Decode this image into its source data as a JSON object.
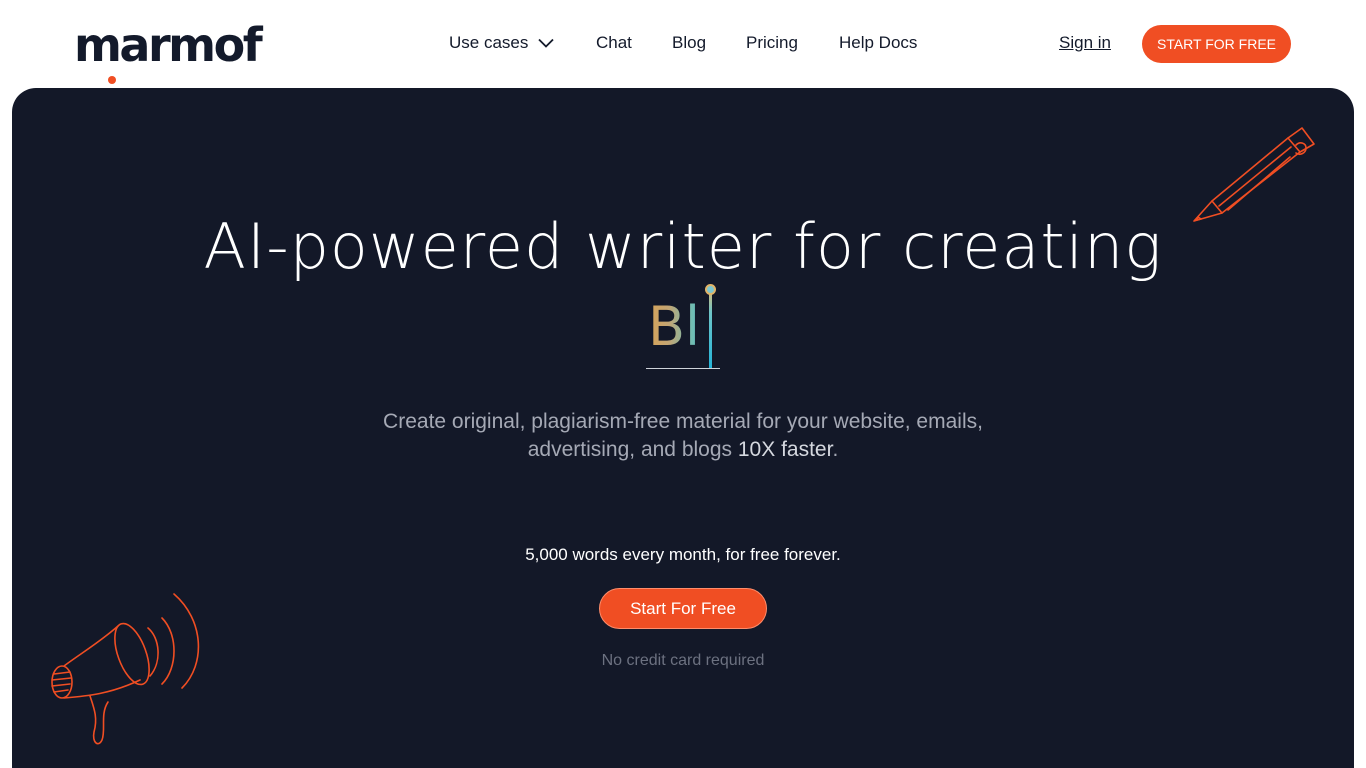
{
  "brand": {
    "name": "marmof",
    "accent_color": "#f04e23",
    "dark_color": "#131828"
  },
  "nav": {
    "items": [
      {
        "label": "Use cases",
        "has_dropdown": true
      },
      {
        "label": "Chat"
      },
      {
        "label": "Blog"
      },
      {
        "label": "Pricing"
      },
      {
        "label": "Help Docs"
      }
    ],
    "sign_in": "Sign in",
    "cta": "START FOR FREE"
  },
  "hero": {
    "title": "AI-powered writer for creating",
    "typed_text": "Bl",
    "subtitle_line1": "Create original, plagiarism-free material for your website, emails,",
    "subtitle_line2_prefix": "advertising, and blogs",
    "subtitle_highlight": "10X faster",
    "subtitle_suffix": ".",
    "words_note": "5,000 words every month, for free forever.",
    "cta": "Start For Free",
    "no_cc": "No credit card required"
  },
  "icons": {
    "chevron": "chevron-down-icon",
    "pencil": "pencil-illustration",
    "megaphone": "megaphone-illustration"
  }
}
